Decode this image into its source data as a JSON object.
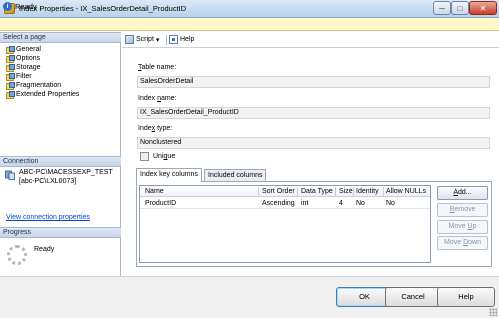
{
  "window": {
    "title": "Index Properties - IX_SalesOrderDetail_ProductID",
    "minimize": "─",
    "maximize": "□",
    "close": "✕",
    "icon": "index-properties-icon"
  },
  "status": {
    "info_icon": "i",
    "text": "Ready"
  },
  "left": {
    "select_page_header": "Select a page",
    "pages": [
      {
        "label": "General"
      },
      {
        "label": "Options"
      },
      {
        "label": "Storage"
      },
      {
        "label": "Filter"
      },
      {
        "label": "Fragmentation"
      },
      {
        "label": "Extended Properties"
      }
    ],
    "connection_header": "Connection",
    "connection_server": "ABC-PC\\MACESSEXP_TEST",
    "connection_user": "[abc-PC\\LXL0073]",
    "view_connection_link": "View connection properties",
    "progress_header": "Progress",
    "progress_status": "Ready"
  },
  "toolbar": {
    "script_label": "Script",
    "script_dropdown": "▾",
    "help_label": "Help"
  },
  "form": {
    "table_name_label_u": "T",
    "table_name_label_rest": "able name:",
    "table_name_value": "SalesOrderDetail",
    "index_name_label_a": "Index ",
    "index_name_label_u": "n",
    "index_name_label_b": "ame:",
    "index_name_value": "IX_SalesOrderDetail_ProductID",
    "index_type_label_a": "Inde",
    "index_type_label_u": "x",
    "index_type_label_b": " type:",
    "index_type_value": "Nonclustered",
    "unique_label_a": "Uni",
    "unique_label_u": "q",
    "unique_label_b": "ue",
    "unique_checked": false
  },
  "tabs": [
    {
      "label": "Index key columns",
      "active": true
    },
    {
      "label": "Included columns",
      "active": false
    }
  ],
  "grid": {
    "columns": [
      "Name",
      "Sort Order",
      "Data Type",
      "Size",
      "Identity",
      "Allow NULLs"
    ],
    "rows": [
      {
        "name": "ProductID",
        "sort_order": "Ascending",
        "data_type": "int",
        "size": "4",
        "identity": "No",
        "allow_nulls": "No"
      }
    ]
  },
  "grid_buttons": {
    "add_u": "A",
    "add_rest": "dd...",
    "remove_u": "R",
    "remove_rest": "emove",
    "move_up_a": "Move ",
    "move_up_u": "U",
    "move_up_b": "p",
    "move_down_a": "Move ",
    "move_down_u": "D",
    "move_down_b": "own"
  },
  "buttons": {
    "ok": "OK",
    "cancel": "Cancel",
    "help": "Help"
  }
}
